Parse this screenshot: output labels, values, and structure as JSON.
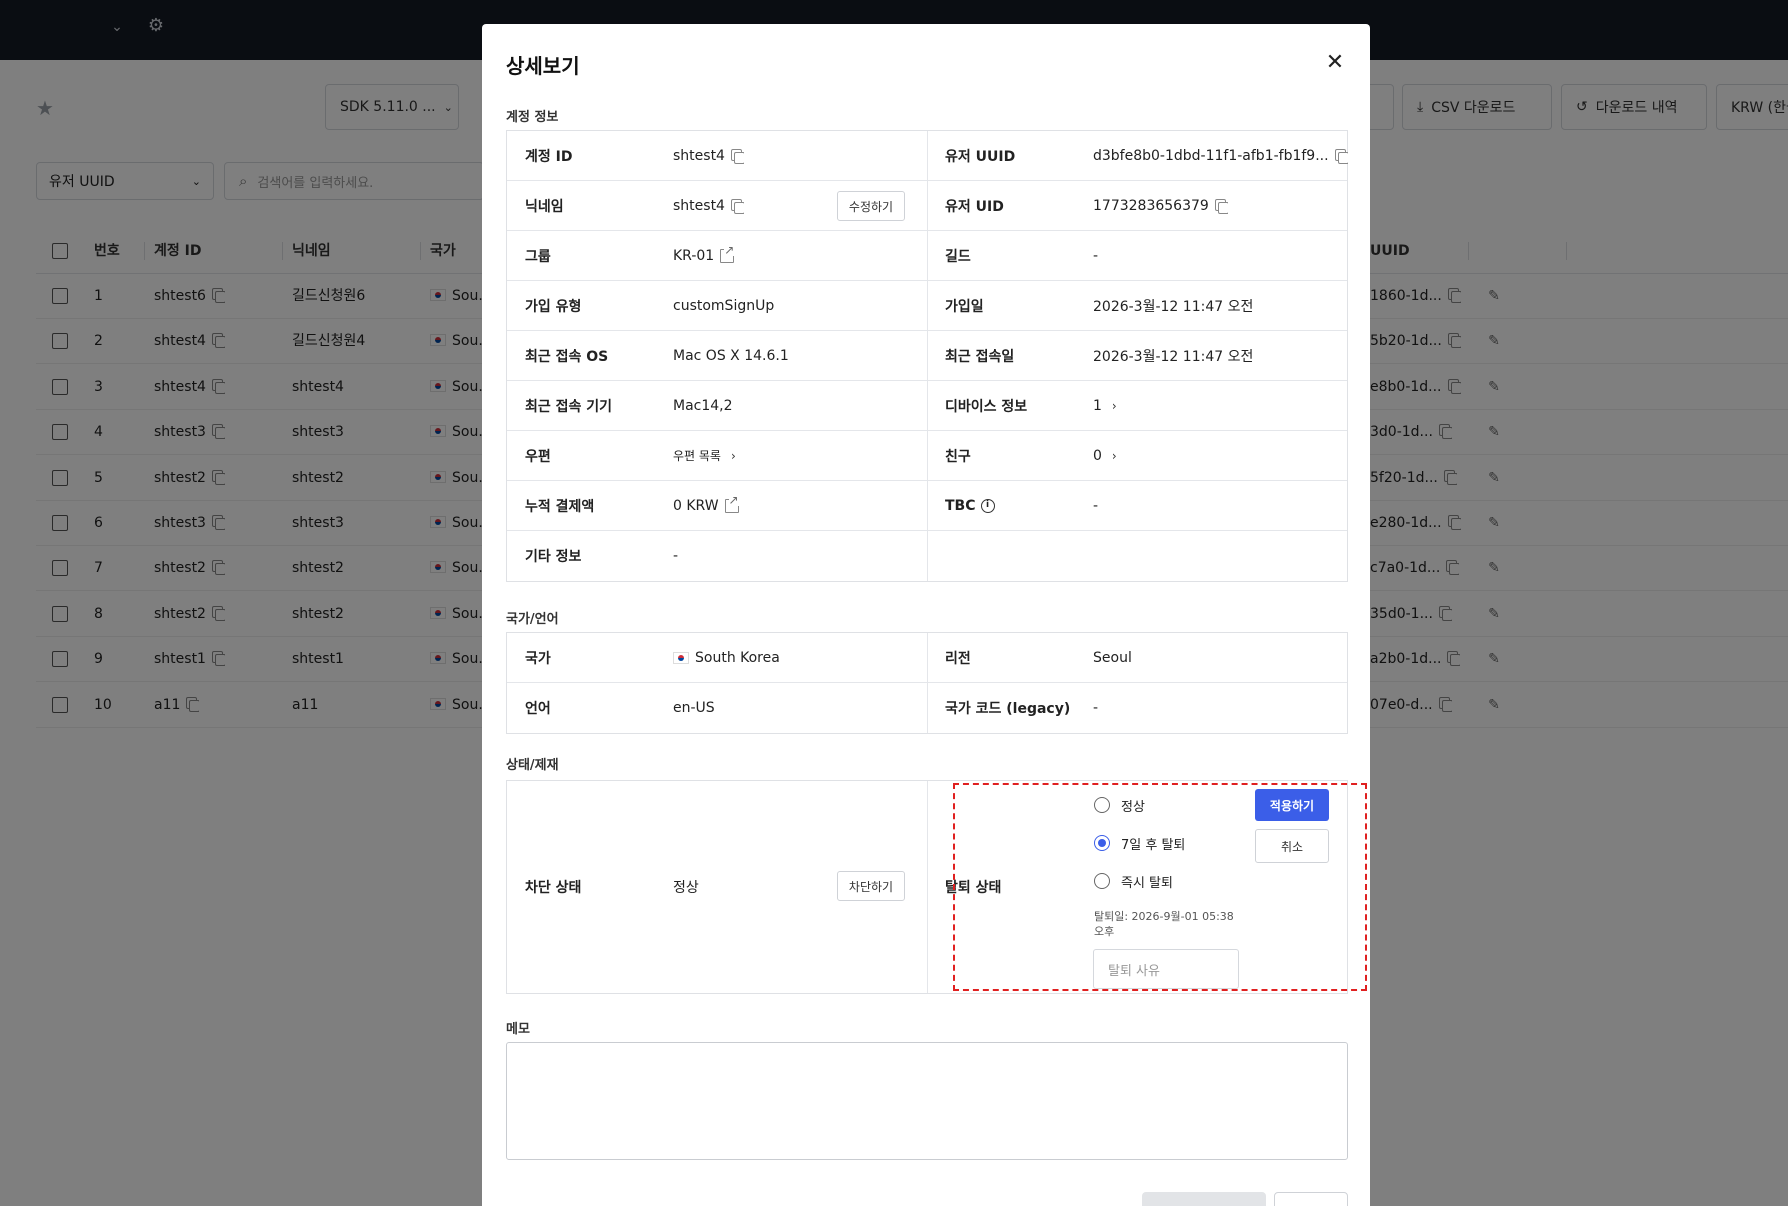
{
  "background": {
    "toolbar": {
      "sdk_select": "SDK 5.11.0 ...",
      "csv_download": "CSV 다운로드",
      "download_history": "다운로드 내역",
      "currency": "KRW (한국"
    },
    "filter": {
      "field_select": "유저 UUID",
      "search_placeholder": "검색어를 입력하세요."
    },
    "table": {
      "headers": [
        "번호",
        "계정 ID",
        "닉네임",
        "국가",
        "UUID"
      ],
      "rows": [
        {
          "no": "1",
          "account_id": "shtest6",
          "nickname": "길드신청원6",
          "country": "Sou...",
          "uuid": "1860-1d..."
        },
        {
          "no": "2",
          "account_id": "shtest4",
          "nickname": "길드신청원4",
          "country": "Sou...",
          "uuid": "5b20-1d..."
        },
        {
          "no": "3",
          "account_id": "shtest4",
          "nickname": "shtest4",
          "country": "Sou...",
          "uuid": "e8b0-1d..."
        },
        {
          "no": "4",
          "account_id": "shtest3",
          "nickname": "shtest3",
          "country": "Sou...",
          "uuid": "3d0-1d..."
        },
        {
          "no": "5",
          "account_id": "shtest2",
          "nickname": "shtest2",
          "country": "Sou...",
          "uuid": "5f20-1d..."
        },
        {
          "no": "6",
          "account_id": "shtest3",
          "nickname": "shtest3",
          "country": "Sou...",
          "uuid": "e280-1d..."
        },
        {
          "no": "7",
          "account_id": "shtest2",
          "nickname": "shtest2",
          "country": "Sou...",
          "uuid": "c7a0-1d..."
        },
        {
          "no": "8",
          "account_id": "shtest2",
          "nickname": "shtest2",
          "country": "Sou...",
          "uuid": "35d0-1..."
        },
        {
          "no": "9",
          "account_id": "shtest1",
          "nickname": "shtest1",
          "country": "Sou...",
          "uuid": "a2b0-1d..."
        },
        {
          "no": "10",
          "account_id": "a11",
          "nickname": "a11",
          "country": "Sou...",
          "uuid": "07e0-d..."
        }
      ]
    }
  },
  "modal": {
    "title": "상세보기",
    "account": {
      "section_title": "계정 정보",
      "account_id_label": "계정 ID",
      "account_id": "shtest4",
      "user_uuid_label": "유저 UUID",
      "user_uuid": "d3bfe8b0-1dbd-11f1-afb1-fb1f9...",
      "nickname_label": "닉네임",
      "nickname": "shtest4",
      "edit_button": "수정하기",
      "user_uid_label": "유저 UID",
      "user_uid": "1773283656379",
      "group_label": "그룹",
      "group": "KR-01",
      "guild_label": "길드",
      "guild": "-",
      "signup_type_label": "가입 유형",
      "signup_type": "customSignUp",
      "signup_date_label": "가입일",
      "signup_date": "2026-3월-12 11:47 오전",
      "last_os_label": "최근 접속 OS",
      "last_os": "Mac OS X 14.6.1",
      "last_login_label": "최근 접속일",
      "last_login": "2026-3월-12 11:47 오전",
      "last_device_label": "최근 접속 기기",
      "last_device": "Mac14,2",
      "device_info_label": "디바이스 정보",
      "device_info": "1",
      "mail_label": "우편",
      "mail": "우편 목록",
      "friends_label": "친구",
      "friends": "0",
      "total_payment_label": "누적 결제액",
      "total_payment": "0 KRW",
      "tbc_label": "TBC",
      "tbc": "-",
      "etc_label": "기타 정보",
      "etc": "-"
    },
    "locale": {
      "section_title": "국가/언어",
      "country_label": "국가",
      "country": "South Korea",
      "region_label": "리전",
      "region": "Seoul",
      "language_label": "언어",
      "language": "en-US",
      "legacy_code_label": "국가 코드 (legacy)",
      "legacy_code": "-"
    },
    "status": {
      "section_title": "상태/제재",
      "block_label": "차단 상태",
      "block_value": "정상",
      "block_button": "차단하기",
      "withdraw_label": "탈퇴 상태",
      "options": [
        "정상",
        "7일 후 탈퇴",
        "즉시 탈퇴"
      ],
      "selected_option": "7일 후 탈퇴",
      "apply_button": "적용하기",
      "cancel_button": "취소",
      "withdraw_date": "탈퇴일: 2026-9월-01 05:38 오후",
      "reason_placeholder": "탈퇴 사유"
    },
    "memo": {
      "section_title": "메모"
    }
  },
  "colors": {
    "accent": "#3b5ee8",
    "highlight_border": "#e02020",
    "topbar": "#141a25"
  }
}
